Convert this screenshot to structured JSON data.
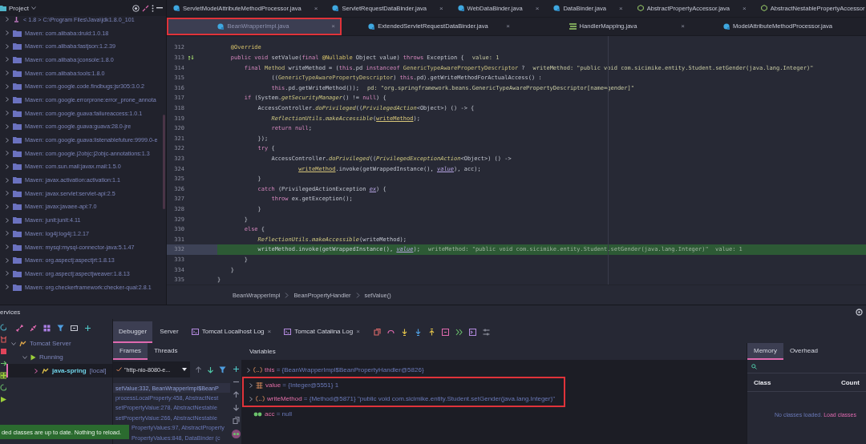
{
  "project_panel": {
    "title": "Project",
    "items": [
      {
        "label": "< 1.8 >  C:\\Program Files\\Java\\jdk1.8.0_101",
        "kind": "sdk"
      },
      {
        "label": "Maven: com.alibaba:druid:1.0.18",
        "kind": "library"
      },
      {
        "label": "Maven: com.alibaba:fastjson:1.2.39",
        "kind": "library"
      },
      {
        "label": "Maven: com.alibaba:jconsole:1.8.0",
        "kind": "library"
      },
      {
        "label": "Maven: com.alibaba:tools:1.8.0",
        "kind": "library"
      },
      {
        "label": "Maven: com.google.code.findbugs:jsr305:3.0.2",
        "kind": "library"
      },
      {
        "label": "Maven: com.google.errorprone:error_prone_annota",
        "kind": "library"
      },
      {
        "label": "Maven: com.google.guava:failureaccess:1.0.1",
        "kind": "library"
      },
      {
        "label": "Maven: com.google.guava:guava:28.0-jre",
        "kind": "library"
      },
      {
        "label": "Maven: com.google.guava:listenablefuture:9999.0-e",
        "kind": "library"
      },
      {
        "label": "Maven: com.google.j2objc:j2objc-annotations:1.3",
        "kind": "library"
      },
      {
        "label": "Maven: com.sun.mail:javax.mail:1.5.0",
        "kind": "library"
      },
      {
        "label": "Maven: javax.activation:activation:1.1",
        "kind": "library"
      },
      {
        "label": "Maven: javax.servlet:servlet-api:2.5",
        "kind": "library"
      },
      {
        "label": "Maven: javax:javaee-api:7.0",
        "kind": "library"
      },
      {
        "label": "Maven: junit:junit:4.11",
        "kind": "library"
      },
      {
        "label": "Maven: log4j:log4j:1.2.17",
        "kind": "library"
      },
      {
        "label": "Maven: mysql:mysql-connector-java:5.1.47",
        "kind": "library"
      },
      {
        "label": "Maven: org.aspectj:aspectjrt:1.8.13",
        "kind": "library"
      },
      {
        "label": "Maven: org.aspectj:aspectjweaver:1.8.13",
        "kind": "library"
      },
      {
        "label": "Maven: org.checkerframework:checker-qual:2.8.1",
        "kind": "library"
      }
    ]
  },
  "editor": {
    "tab_rows": [
      [
        {
          "label": "ServletModelAttributeMethodProcessor.java",
          "kind": "class",
          "close": "×",
          "selected": false,
          "outlined": false
        },
        {
          "label": "ServletRequestDataBinder.java",
          "kind": "class",
          "close": "×",
          "selected": false,
          "outlined": false
        },
        {
          "label": "WebDataBinder.java",
          "kind": "class",
          "close": "×",
          "selected": false,
          "outlined": false
        },
        {
          "label": "DataBinder.java",
          "kind": "class",
          "close": "×",
          "selected": false,
          "outlined": false
        },
        {
          "label": "AbstractPropertyAccessor.java",
          "kind": "abstract",
          "close": "×",
          "selected": false,
          "outlined": false
        },
        {
          "label": "AbstractNestablePropertyAccessor",
          "kind": "abstract",
          "selected": false,
          "outlined": false
        }
      ],
      [
        {
          "label": "BeanWrapperImpl.java",
          "kind": "class",
          "close": "×",
          "selected": true,
          "outlined": true
        },
        {
          "label": "ExtendedServletRequestDataBinder.java",
          "kind": "class",
          "close": "×",
          "selected": false,
          "outlined": false
        },
        {
          "label": "HandlerMapping.java",
          "kind": "interface",
          "close": "×",
          "selected": false,
          "outlined": false
        },
        {
          "label": "ModelAttributeMethodProcessor.java",
          "kind": "class",
          "selected": false,
          "outlined": false
        }
      ]
    ],
    "lines": [
      {
        "number": "312",
        "current": false,
        "marker": false,
        "segments": [
          {
            "text": "    @Override",
            "kind": "ann"
          }
        ]
      },
      {
        "number": "313",
        "current": false,
        "marker": true,
        "segments": [
          {
            "text": "    public void ",
            "kind": "kw"
          },
          {
            "text": "setValue(",
            "kind": "plain"
          },
          {
            "text": "final ",
            "kind": "kw"
          },
          {
            "text": "@Nullable",
            "kind": "ann"
          },
          {
            "text": " Object value) ",
            "kind": "plain"
          },
          {
            "text": "throws",
            "kind": "kw"
          },
          {
            "text": " Exception {",
            "kind": "plain"
          }
        ],
        "hint": "value: 1"
      },
      {
        "number": "314",
        "current": false,
        "marker": false,
        "segments": [
          {
            "text": "        final ",
            "kind": "kw"
          },
          {
            "text": "Method",
            "kind": "type"
          },
          {
            "text": " writeMethod = (",
            "kind": "plain"
          },
          {
            "text": "this",
            "kind": "kw"
          },
          {
            "text": ".pd ",
            "kind": "plain"
          },
          {
            "text": "instanceof ",
            "kind": "kw"
          },
          {
            "text": "GenericTypeAwarePropertyDescriptor",
            "kind": "type"
          },
          {
            "text": " ?",
            "kind": "plain"
          }
        ],
        "hint": "writeMethod: \"public void com.sicimike.entity.Student.setGender(java.lang.Integer)\""
      },
      {
        "number": "315",
        "current": false,
        "marker": false,
        "segments": [
          {
            "text": "                ((",
            "kind": "plain"
          },
          {
            "text": "GenericTypeAwarePropertyDescriptor",
            "kind": "type"
          },
          {
            "text": ") ",
            "kind": "plain"
          },
          {
            "text": "this",
            "kind": "kw"
          },
          {
            "text": ".pd).getWriteMethodForActualAccess() :",
            "kind": "plain"
          }
        ]
      },
      {
        "number": "316",
        "current": false,
        "marker": false,
        "segments": [
          {
            "text": "                this",
            "kind": "kw"
          },
          {
            "text": ".pd.getWriteMethod());",
            "kind": "plain"
          }
        ],
        "hint": "pd: \"org.springframework.beans.GenericTypeAwarePropertyDescriptor[name=gender]\""
      },
      {
        "number": "317",
        "current": false,
        "marker": false,
        "segments": [
          {
            "text": "        if",
            "kind": "kw"
          },
          {
            "text": " (System.",
            "kind": "plain"
          },
          {
            "text": "getSecurityManager",
            "kind": "call"
          },
          {
            "text": "() != ",
            "kind": "plain"
          },
          {
            "text": "null",
            "kind": "kw"
          },
          {
            "text": ") {",
            "kind": "plain"
          }
        ]
      },
      {
        "number": "318",
        "current": false,
        "marker": false,
        "segments": [
          {
            "text": "            AccessController.",
            "kind": "plain"
          },
          {
            "text": "doPrivileged",
            "kind": "call"
          },
          {
            "text": "((",
            "kind": "plain"
          },
          {
            "text": "PrivilegedAction",
            "kind": "call"
          },
          {
            "text": "<Object>) () -> {",
            "kind": "plain"
          }
        ]
      },
      {
        "number": "319",
        "current": false,
        "marker": false,
        "segments": [
          {
            "text": "                ReflectionUtils",
            "kind": "call"
          },
          {
            "text": ".",
            "kind": "plain"
          },
          {
            "text": "makeAccessible",
            "kind": "call"
          },
          {
            "text": "(",
            "kind": "plain"
          },
          {
            "text": "writeMethod",
            "kind": "ul"
          },
          {
            "text": ");",
            "kind": "plain"
          }
        ]
      },
      {
        "number": "320",
        "current": false,
        "marker": false,
        "segments": [
          {
            "text": "                return null",
            "kind": "kw"
          },
          {
            "text": ";",
            "kind": "plain"
          }
        ]
      },
      {
        "number": "321",
        "current": false,
        "marker": false,
        "segments": [
          {
            "text": "            });",
            "kind": "plain"
          }
        ]
      },
      {
        "number": "322",
        "current": false,
        "marker": false,
        "segments": [
          {
            "text": "            try",
            "kind": "kw"
          },
          {
            "text": " {",
            "kind": "plain"
          }
        ]
      },
      {
        "number": "323",
        "current": false,
        "marker": false,
        "segments": [
          {
            "text": "                AccessController.",
            "kind": "plain"
          },
          {
            "text": "doPrivileged",
            "kind": "call"
          },
          {
            "text": "((",
            "kind": "plain"
          },
          {
            "text": "PrivilegedExceptionAction",
            "kind": "call"
          },
          {
            "text": "<Object>) () ->",
            "kind": "plain"
          }
        ]
      },
      {
        "number": "324",
        "current": false,
        "marker": false,
        "segments": [
          {
            "text": "                        writeMethod",
            "kind": "ul"
          },
          {
            "text": ".invoke(getWrappedInstance(), ",
            "kind": "plain"
          },
          {
            "text": "value",
            "kind": "param"
          },
          {
            "text": "), acc);",
            "kind": "plain"
          }
        ]
      },
      {
        "number": "325",
        "current": false,
        "marker": false,
        "segments": [
          {
            "text": "            }",
            "kind": "plain"
          }
        ]
      },
      {
        "number": "326",
        "current": false,
        "marker": false,
        "segments": [
          {
            "text": "            catch",
            "kind": "kw"
          },
          {
            "text": " (PrivilegedActionException ",
            "kind": "plain"
          },
          {
            "text": "ex",
            "kind": "param"
          },
          {
            "text": ") {",
            "kind": "plain"
          }
        ]
      },
      {
        "number": "327",
        "current": false,
        "marker": false,
        "segments": [
          {
            "text": "                throw",
            "kind": "kw"
          },
          {
            "text": " ex.getException();",
            "kind": "plain"
          }
        ]
      },
      {
        "number": "328",
        "current": false,
        "marker": false,
        "segments": [
          {
            "text": "            }",
            "kind": "plain"
          }
        ]
      },
      {
        "number": "329",
        "current": false,
        "marker": false,
        "segments": [
          {
            "text": "        }",
            "kind": "plain"
          }
        ]
      },
      {
        "number": "330",
        "current": false,
        "marker": false,
        "segments": [
          {
            "text": "        else",
            "kind": "kw"
          },
          {
            "text": " {",
            "kind": "plain"
          }
        ]
      },
      {
        "number": "331",
        "current": false,
        "marker": false,
        "segments": [
          {
            "text": "            ReflectionUtils",
            "kind": "call"
          },
          {
            "text": ".",
            "kind": "plain"
          },
          {
            "text": "makeAccessible",
            "kind": "call"
          },
          {
            "text": "(writeMethod);",
            "kind": "plain"
          }
        ]
      },
      {
        "number": "332",
        "current": true,
        "marker": false,
        "segments": [
          {
            "text": "            writeMethod.invoke(getWrappedInstance(), ",
            "kind": "plain"
          },
          {
            "text": "value",
            "kind": "param"
          },
          {
            "text": ");",
            "kind": "plain"
          }
        ],
        "hint": "writeMethod: \"public void com.sicimike.entity.Student.setGender(java.lang.Integer)\"  value: 1"
      },
      {
        "number": "333",
        "current": false,
        "marker": false,
        "segments": [
          {
            "text": "        }",
            "kind": "plain"
          }
        ]
      },
      {
        "number": "334",
        "current": false,
        "marker": false,
        "segments": [
          {
            "text": "    }",
            "kind": "plain"
          }
        ]
      },
      {
        "number": "335",
        "current": false,
        "marker": false,
        "segments": [
          {
            "text": "}",
            "kind": "plain"
          }
        ]
      }
    ],
    "breadcrumbs": [
      "BeanWrapperImpl",
      "BeanPropertyHandler",
      "setValue()"
    ]
  },
  "services": {
    "title": "ervices",
    "tree": [
      {
        "label": "Tomcat Server",
        "expanded": true,
        "selected": false,
        "children": [
          {
            "label": "Running",
            "expanded": true,
            "selected": false,
            "children": [
              {
                "label": "java-spring",
                "detail": "[local]",
                "expanded": false,
                "selected": true
              }
            ]
          }
        ]
      }
    ],
    "tabs": [
      {
        "label": "Debugger",
        "selected": true,
        "console": false
      },
      {
        "label": "Server",
        "selected": false,
        "console": false
      },
      {
        "label": "Tomcat Localhost Log",
        "selected": false,
        "close": "×",
        "console": true
      },
      {
        "label": "Tomcat Catalina Log",
        "selected": false,
        "close": "×",
        "console": true
      }
    ],
    "frame_tabs": [
      {
        "label": "Frames",
        "selected": true
      },
      {
        "label": "Threads",
        "selected": false
      }
    ],
    "thread": "\"http-nio-8080-e...",
    "frames": [
      {
        "text": "setValue:332, BeanWrapperImpl$BeanP",
        "selected": true
      },
      {
        "text": "processLocalProperty:458, AbstractNest",
        "selected": false
      },
      {
        "text": "setPropertyValue:278, AbstractNestable",
        "selected": false
      },
      {
        "text": "setPropertyValue:266, AbstractNestable",
        "selected": false
      },
      {
        "text": "PropertyValues:97, AbstractProperty",
        "selected": false
      },
      {
        "text": "PropertyValues:848, DataBinder (c",
        "selected": false
      }
    ],
    "variables_title": "Variables",
    "variables": [
      {
        "name": "this",
        "value": "= {BeanWrapperImpl$BeanPropertyHandler@5826}",
        "kind": "object",
        "outlined": false
      },
      {
        "name": "value",
        "value": "= {Integer@5551} 1",
        "kind": "primitive",
        "outlined": true
      },
      {
        "name": "writeMethod",
        "value": "= {Method@5871} \"public void com.sicimike.entity.Student.setGender(java.lang.Integer)\"",
        "kind": "object",
        "outlined": true
      },
      {
        "name": "acc",
        "value": "= null",
        "kind": "watch",
        "outlined": false
      }
    ],
    "memory_tabs": [
      {
        "label": "Memory",
        "selected": true
      },
      {
        "label": "Overhead",
        "selected": false
      }
    ],
    "memory_columns": [
      "Class",
      "Count"
    ],
    "memory_empty": "No classes loaded.",
    "memory_link": "Load classes"
  },
  "notification": "ded classes are up to date. Nothing to reload."
}
